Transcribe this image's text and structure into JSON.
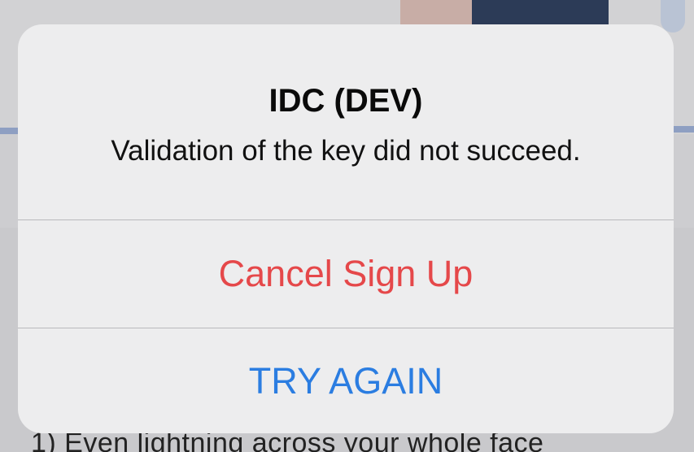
{
  "background": {
    "visible_text": "1) Even lightning across your whole face"
  },
  "alert": {
    "title": "IDC (DEV)",
    "message": "Validation of the key did not succeed.",
    "buttons": {
      "cancel_label": "Cancel Sign Up",
      "retry_label": "TRY AGAIN"
    }
  },
  "colors": {
    "destructive": "#e5484a",
    "action": "#2b7de1",
    "alert_background": "#ededee"
  }
}
